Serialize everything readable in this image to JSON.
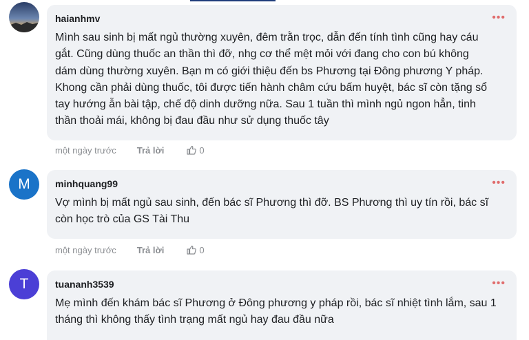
{
  "comments": [
    {
      "author": "haianhmv",
      "avatar_letter": "",
      "avatar_color": "#2c4a78",
      "text": "Mình sau sinh bị mất ngủ thường xuyên, đêm trằn trọc, dẫn đến tính tình cũng hay cáu\ngắt. Cũng dùng thuốc an thần thì đỡ, nhg cơ thể mệt mỏi với đang cho con bú không\ndám dùng thường xuyên. Bạn m có giới thiệu đến bs Phương tại Đông phương Y pháp.\nKhong cần phải dùng thuốc, tôi được tiến hành châm cứu bấm huyệt, bác sĩ còn tặng sổ\ntay hướng ẫn bài tập, chế độ dinh dưỡng nữa. Sau 1 tuần thì mình ngủ ngon hẳn, tinh\nthần thoải mái, không bị đau đầu như sử dụng thuốc tây",
      "time": "một ngày trước",
      "reply": "Trả lời",
      "likes": "0"
    },
    {
      "author": "minhquang99",
      "avatar_letter": "M",
      "avatar_color": "#1a73c8",
      "text": "Vợ mình bị mất ngủ sau sinh, đến bác sĩ Phương thì đỡ. BS Phương thì uy tín rồi, bác sĩ\ncòn học trò của GS Tài Thu",
      "time": "một ngày trước",
      "reply": "Trả lời",
      "likes": "0"
    },
    {
      "author": "tuananh3539",
      "avatar_letter": "T",
      "avatar_color": "#4b3fd6",
      "text": "Mẹ mình đến khám bác sĩ Phương ở Đông phương y pháp rồi, bác sĩ nhiệt tình lắm, sau 1\ntháng thì không thấy tình trạng mất ngủ hay đau đầu nữa",
      "time": "",
      "reply": "",
      "likes": ""
    }
  ],
  "menu_icon": "more-dots-icon",
  "like_icon": "thumbs-up-icon",
  "accent_dots_color": "#e06c6c"
}
